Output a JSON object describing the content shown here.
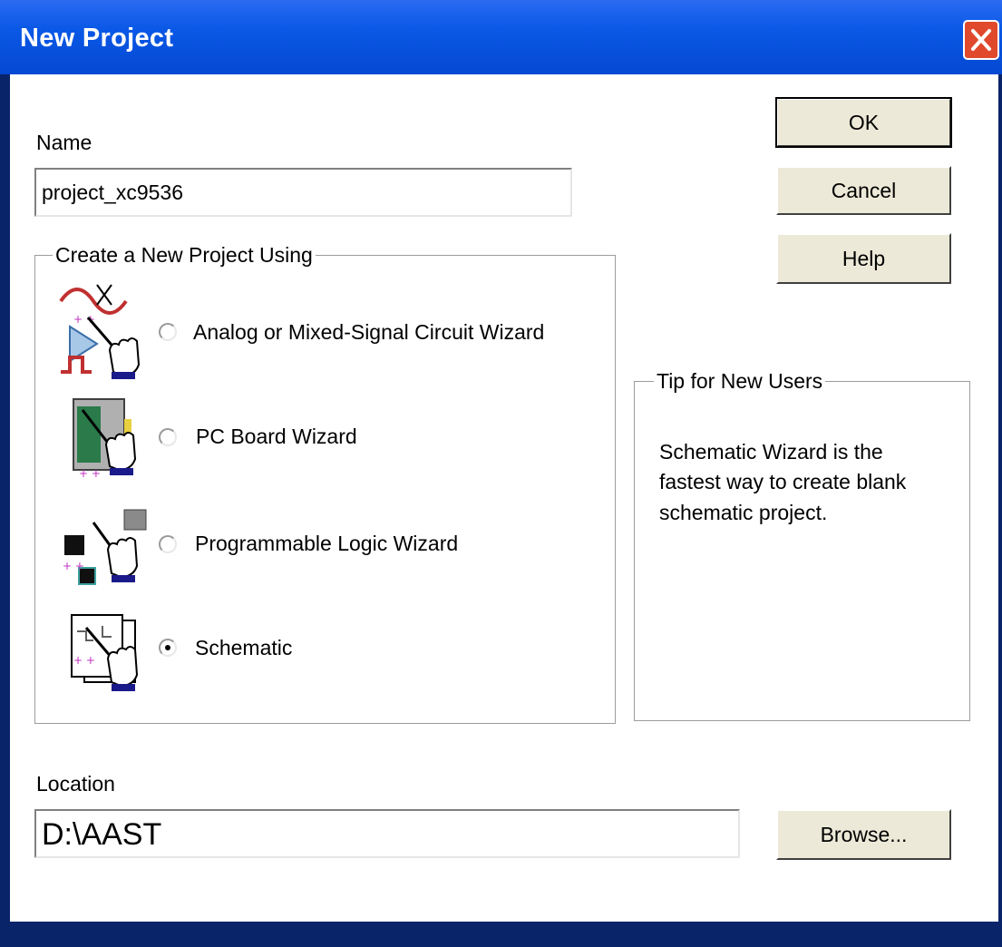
{
  "window": {
    "title": "New Project"
  },
  "name_field": {
    "label": "Name",
    "value": "project_xc9536"
  },
  "buttons": {
    "ok": "OK",
    "cancel": "Cancel",
    "help": "Help",
    "browse": "Browse..."
  },
  "create_group": {
    "legend": "Create a New Project Using",
    "options": [
      {
        "label": "Analog or Mixed-Signal Circuit Wizard",
        "icon": "analog-wizard-icon",
        "selected": false
      },
      {
        "label": "PC Board Wizard",
        "icon": "pc-board-wizard-icon",
        "selected": false
      },
      {
        "label": "Programmable Logic Wizard",
        "icon": "programmable-logic-wizard-icon",
        "selected": false
      },
      {
        "label": "Schematic",
        "icon": "schematic-icon",
        "selected": true
      }
    ]
  },
  "tip_group": {
    "legend": "Tip for New Users",
    "lines": [
      "Schematic Wizard is the",
      "fastest way to create blank",
      "schematic project."
    ]
  },
  "location_field": {
    "label": "Location",
    "value": "D:\\AAST"
  },
  "colors": {
    "title_bar": "#0a58e6",
    "close_button": "#e0492c",
    "button_face": "#ece9d8"
  }
}
